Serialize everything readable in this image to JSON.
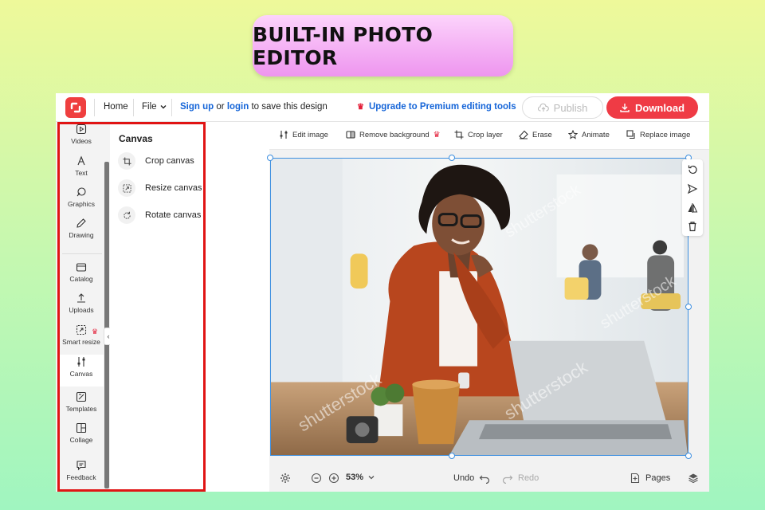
{
  "banner": {
    "title": "BUILT-IN PHOTO EDITOR"
  },
  "topbar": {
    "home": "Home",
    "file": "File",
    "signup": "Sign up",
    "or": "or",
    "login": "login",
    "save_text": "to save this design",
    "premium": "Upgrade to Premium editing tools",
    "publish": "Publish",
    "download": "Download"
  },
  "rail": {
    "items": [
      {
        "label": "Videos",
        "icon": "play-icon"
      },
      {
        "label": "Text",
        "icon": "text-icon"
      },
      {
        "label": "Graphics",
        "icon": "graphics-icon"
      },
      {
        "label": "Drawing",
        "icon": "pen-icon"
      },
      {
        "label": "Catalog",
        "icon": "catalog-icon"
      },
      {
        "label": "Uploads",
        "icon": "upload-icon"
      },
      {
        "label": "Smart resize",
        "icon": "resize-icon"
      },
      {
        "label": "Canvas",
        "icon": "sliders-icon"
      },
      {
        "label": "Templates",
        "icon": "templates-icon"
      },
      {
        "label": "Collage",
        "icon": "collage-icon"
      },
      {
        "label": "Feedback",
        "icon": "chat-icon"
      }
    ],
    "active": "Canvas"
  },
  "panel": {
    "title": "Canvas",
    "items": [
      {
        "label": "Crop canvas",
        "icon": "crop-icon"
      },
      {
        "label": "Resize canvas",
        "icon": "resize-icon"
      },
      {
        "label": "Rotate canvas",
        "icon": "rotate-icon"
      }
    ]
  },
  "toolbar": {
    "edit_image": "Edit image",
    "remove_background": "Remove background",
    "crop_layer": "Crop layer",
    "erase": "Erase",
    "animate": "Animate",
    "replace_image": "Replace image"
  },
  "watermark": {
    "text": "shutterstock"
  },
  "bottombar": {
    "zoom": "53%",
    "undo": "Undo",
    "redo": "Redo",
    "pages": "Pages"
  },
  "colors": {
    "accent": "#ef3b45",
    "link": "#1565d8",
    "selection": "#3d8fe0",
    "highlight": "#e01414"
  }
}
